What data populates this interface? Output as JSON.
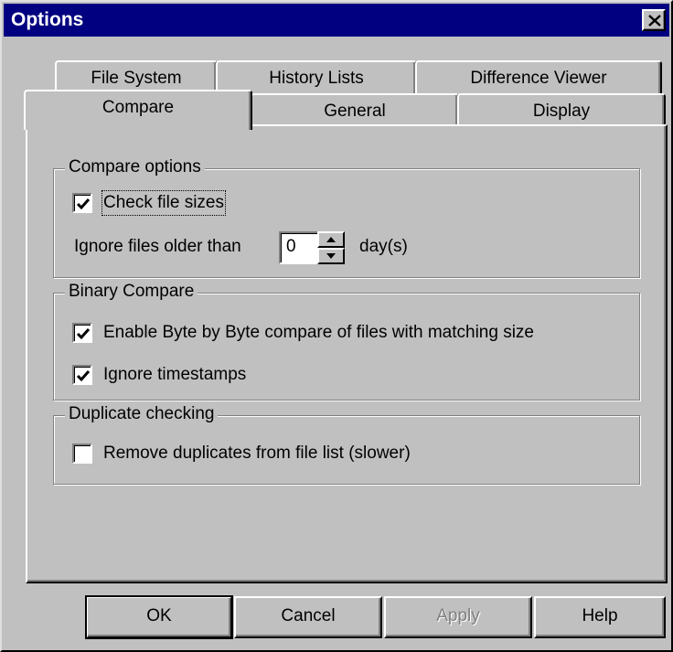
{
  "window": {
    "title": "Options",
    "close_glyph": "×"
  },
  "tabs": {
    "back_row": [
      "File System",
      "History Lists",
      "Difference Viewer"
    ],
    "front_row": [
      "Compare",
      "General",
      "Display"
    ],
    "selected": "Compare"
  },
  "compare_options": {
    "group_label": "Compare options",
    "check_file_sizes": {
      "label": "Check file sizes",
      "checked": true
    },
    "ignore_older_label": "Ignore files older than",
    "ignore_older_value": "0",
    "days_label": "day(s)"
  },
  "binary_compare": {
    "group_label": "Binary Compare",
    "byte_by_byte": {
      "label": "Enable Byte by Byte compare of files with matching size",
      "checked": true
    },
    "ignore_timestamps": {
      "label": "Ignore timestamps",
      "checked": true
    }
  },
  "duplicate_checking": {
    "group_label": "Duplicate checking",
    "remove_duplicates": {
      "label": "Remove duplicates from file list (slower)",
      "checked": false
    }
  },
  "buttons": {
    "ok": "OK",
    "cancel": "Cancel",
    "apply": "Apply",
    "help": "Help"
  },
  "icons": {
    "close": "close-icon",
    "checkmark": "checkmark-icon",
    "spin_up": "triangle-up-icon",
    "spin_down": "triangle-down-icon"
  }
}
